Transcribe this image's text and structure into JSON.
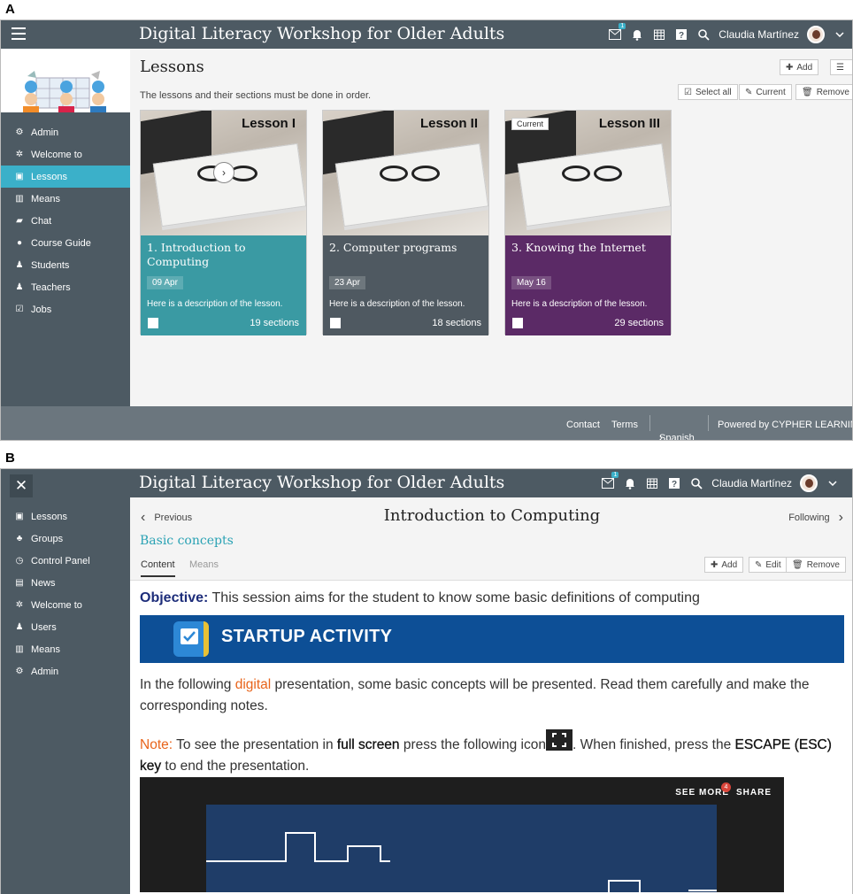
{
  "panel_a": {
    "label": "A",
    "topbar": {
      "title": "Digital Literacy Workshop for Older Adults",
      "mail_badge": "1",
      "user_name": "Claudia Martínez"
    },
    "sidebar_items": [
      {
        "label": "Admin",
        "icon": "gear-icon"
      },
      {
        "label": "Welcome to",
        "icon": "sun-icon"
      },
      {
        "label": "Lessons",
        "icon": "book-icon",
        "active": true
      },
      {
        "label": "Means",
        "icon": "building-icon"
      },
      {
        "label": "Chat",
        "icon": "chat-icon"
      },
      {
        "label": "Course Guide",
        "icon": "info-icon"
      },
      {
        "label": "Students",
        "icon": "user-icon"
      },
      {
        "label": "Teachers",
        "icon": "user-icon"
      },
      {
        "label": "Jobs",
        "icon": "checkbox-icon"
      }
    ],
    "page_title": "Lessons",
    "add_label": "Add",
    "subtitle": "The lessons and their sections must be done in order.",
    "select_all_label": "Select all",
    "current_label": "Current",
    "remove_label": "Remove",
    "lessons": [
      {
        "name": "Lesson I",
        "title": "1. Introduction to Computing",
        "date": "09 Apr",
        "description": "Here is a description of the lesson.",
        "sections": "19 sections",
        "color": "#3a9aa3",
        "current_tag": ""
      },
      {
        "name": "Lesson II",
        "title": "2. Computer programs",
        "date": "23 Apr",
        "description": "Here is a description of the lesson.",
        "sections": "18 sections",
        "color": "#4f5961",
        "current_tag": ""
      },
      {
        "name": "Lesson III",
        "title": "3. Knowing the Internet",
        "date": "May 16",
        "description": "Here is a description of the lesson.",
        "sections": "29 sections",
        "color": "#5b2a66",
        "current_tag": "Current"
      }
    ],
    "footer": {
      "contact": "Contact",
      "terms": "Terms",
      "language": "Spanish",
      "powered": "Powered by CYPHER LEARNING"
    }
  },
  "panel_b": {
    "label": "B",
    "topbar": {
      "title": "Digital Literacy Workshop for Older Adults",
      "mail_badge": "1",
      "user_name": "Claudia Martínez"
    },
    "sidebar_items": [
      {
        "label": "Lessons",
        "icon": "book-icon"
      },
      {
        "label": "Groups",
        "icon": "group-icon"
      },
      {
        "label": "Control Panel",
        "icon": "dashboard-icon"
      },
      {
        "label": "News",
        "icon": "news-icon"
      },
      {
        "label": "Welcome to",
        "icon": "sun-icon"
      },
      {
        "label": "Users",
        "icon": "user-icon"
      },
      {
        "label": "Means",
        "icon": "building-icon"
      },
      {
        "label": "Admin",
        "icon": "gear-icon"
      }
    ],
    "nav": {
      "previous": "Previous",
      "page_title": "Introduction to Computing",
      "following": "Following"
    },
    "section_title": "Basic concepts",
    "tabs": [
      "Content",
      "Means"
    ],
    "add_label": "Add",
    "edit_label": "Edit",
    "remove_label": "Remove",
    "objective_label": "Objective:",
    "objective_text": "This session aims for the student to know some basic definitions of computing",
    "banner_text": "STARTUP ACTIVITY",
    "para1_a": "In the following ",
    "para1_highlight": "digital",
    "para1_b": " presentation, some basic concepts will be presented. Read them carefully and make the corresponding notes.",
    "note_label": "Note:",
    "note_a": " To see the presentation in ",
    "note_bold1": "full screen",
    "note_b": " press the following icon",
    "note_c": ". When finished, press the ",
    "note_bold2": "ESCAPE (ESC) key",
    "note_d": " to end the presentation.",
    "video": {
      "see_more": "SEE MORE",
      "see_more_badge": "4",
      "share": "SHARE"
    }
  }
}
